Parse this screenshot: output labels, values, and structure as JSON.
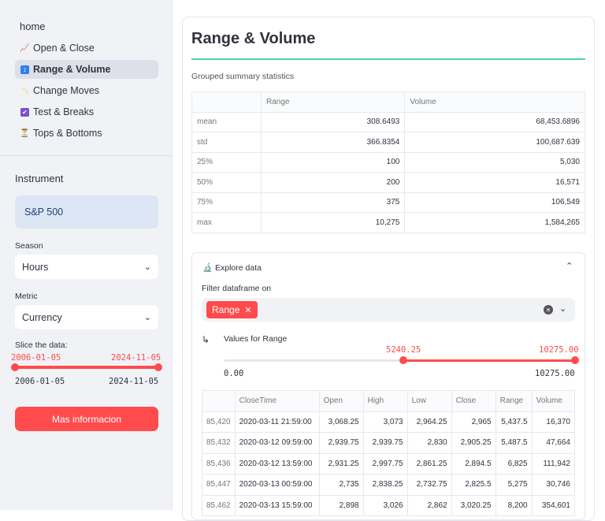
{
  "sidebar": {
    "home": "home",
    "nav": [
      {
        "label": "Open & Close",
        "icon": "chart-icon",
        "glyph": "📈"
      },
      {
        "label": "Range & Volume",
        "icon": "updown-icon",
        "glyph": "↕"
      },
      {
        "label": "Change Moves",
        "icon": "wave-icon",
        "glyph": "〽"
      },
      {
        "label": "Test & Breaks",
        "icon": "check-box-icon",
        "glyph": "✔"
      },
      {
        "label": "Tops & Bottoms",
        "icon": "timer-icon",
        "glyph": "⏳"
      }
    ],
    "instrument_heading": "Instrument",
    "instrument_value": "S&P 500",
    "season_label": "Season",
    "season_value": "Hours",
    "metric_label": "Metric",
    "metric_value": "Currency",
    "slice_label": "Slice the data:",
    "slice_start": "2006-01-05",
    "slice_end": "2024-11-05",
    "button_label": "Mas informacion"
  },
  "main": {
    "title": "Range & Volume",
    "subtitle": "Grouped summary statistics",
    "stats": {
      "headers": [
        "",
        "Range",
        "Volume"
      ],
      "rows": [
        [
          "mean",
          "308.6493",
          "68,453.6896"
        ],
        [
          "std",
          "366.8354",
          "100,687.639"
        ],
        [
          "25%",
          "100",
          "5,030"
        ],
        [
          "50%",
          "200",
          "16,571"
        ],
        [
          "75%",
          "375",
          "106,549"
        ],
        [
          "max",
          "10,275",
          "1,584,265"
        ]
      ]
    },
    "explore": {
      "title": "Explore data",
      "filter_label": "Filter dataframe on",
      "chip": "Range",
      "values_label": "Values for Range",
      "slider_low": "5240.25",
      "slider_high": "10275.00",
      "slider_min": "0.00",
      "slider_max": "10275.00",
      "slider_low_fraction": 0.51,
      "table": {
        "headers": [
          "",
          "CloseTime",
          "Open",
          "High",
          "Low",
          "Close",
          "Range",
          "Volume"
        ],
        "rows": [
          [
            "85,420",
            "2020-03-11 21:59:00",
            "3,068.25",
            "3,073",
            "2,964.25",
            "2,965",
            "5,437.5",
            "16,370"
          ],
          [
            "85,432",
            "2020-03-12 09:59:00",
            "2,939.75",
            "2,939.75",
            "2,830",
            "2,905.25",
            "5,487.5",
            "47,664"
          ],
          [
            "85,436",
            "2020-03-12 13:59:00",
            "2,931.25",
            "2,997.75",
            "2,861.25",
            "2,894.5",
            "6,825",
            "111,942"
          ],
          [
            "85,447",
            "2020-03-13 00:59:00",
            "2,735",
            "2,838.25",
            "2,732.75",
            "2,825.5",
            "5,275",
            "30,746"
          ],
          [
            "85,462",
            "2020-03-13 15:59:00",
            "2,898",
            "3,026",
            "2,862",
            "3,020.25",
            "8,200",
            "354,601"
          ]
        ]
      }
    }
  },
  "colors": {
    "accent": "#ff4b4b",
    "underline": "#4fd1b2",
    "instrument_bg": "#dce6f4"
  }
}
